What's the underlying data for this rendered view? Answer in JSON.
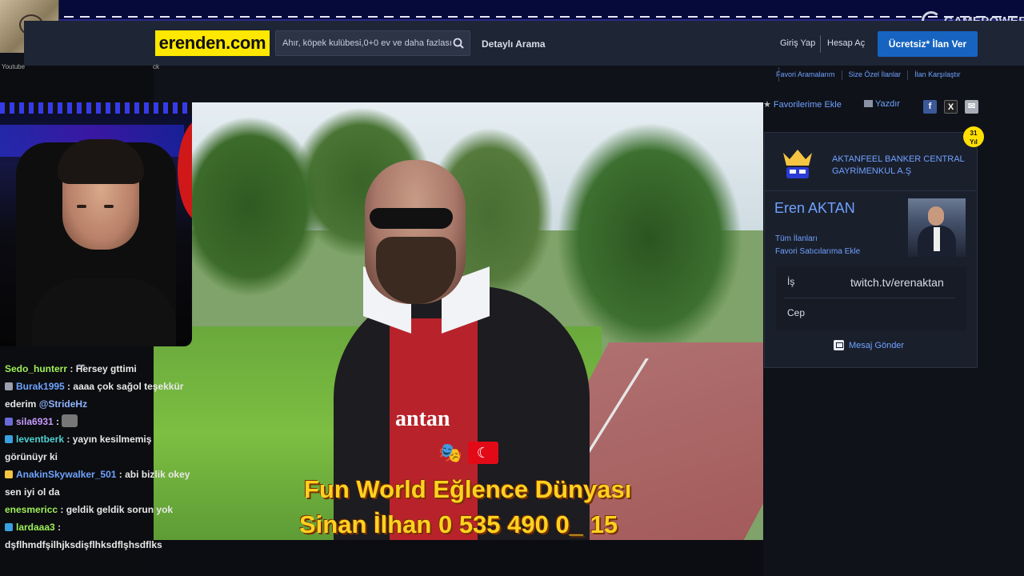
{
  "stream": {
    "youtube_label": "Youtube",
    "tk_label": "ck",
    "overlay_logo": "GAMEPOWER"
  },
  "site": {
    "brand": "erenden.com",
    "search_placeholder": "Ahır, köpek kulübesi,0+0 ev ve daha fazlası",
    "detailed_search": "Detaylı Arama",
    "login": "Giriş Yap",
    "signup": "Hesap Aç",
    "post_ad": "Ücretsiz* İlan Ver",
    "sub_links": [
      "Favori Aramalarım",
      "Size Özel İlanlar",
      "İlan Karşılaştır"
    ],
    "brand_color": "#ffe800",
    "accent_color": "#1664c0",
    "link_color": "#6fa2ff"
  },
  "listing": {
    "add_favorites": "Favorilerime Ekle",
    "print": "Yazdır",
    "social": [
      "f",
      "X",
      "✉"
    ]
  },
  "seller": {
    "badge_value": "31",
    "badge_unit": "Yıl",
    "company": "AKTANFEEL BANKER CENTRAL GAYRİMENKUL A.Ş",
    "name": "Eren AKTAN",
    "all_ads": "Tüm İlanları",
    "fav_seller": "Favori Satıcılarıma Ekle",
    "work_label": "İş",
    "work_value": "twitch.tv/erenaktan",
    "mobile_label": "Cep",
    "message": "Mesaj Gönder"
  },
  "video": {
    "shirt_text": "antan",
    "caption_line1": "Fun World Eğlence Dünyası",
    "caption_line2": "Sinan İlhan 0 535 490 0_ 15"
  },
  "chat": {
    "messages": [
      {
        "user": "Sedo_hunterr",
        "color": "#9ef05a",
        "badge": "",
        "text": "Hersey gttimi"
      },
      {
        "user": "Burak1995",
        "color": "#6fa2ff",
        "badge": "#9aa0ad",
        "text": "aaaa çok sağol teşekkür ederim",
        "mention": "@StrideHz"
      },
      {
        "user": "sila6931",
        "color": "#c79bff",
        "badge": "#6a6ad8",
        "text": "",
        "emote": "cat-emote"
      },
      {
        "user": "leventberk",
        "color": "#4fd1d1",
        "badge": "#3aa0e0",
        "text": "yayın kesilmemiş görünüyr ki"
      },
      {
        "user": "AnakinSkywalker_501",
        "color": "#6fa2ff",
        "badge": "#f5c542",
        "text": "abi bizlik okey sen iyi ol da"
      },
      {
        "user": "enesmericc",
        "color": "#9ef05a",
        "badge": "",
        "text": "geldik geldik sorun yok"
      },
      {
        "user": "lardaaa3",
        "color": "#9ef05a",
        "badge": "#3aa0e0",
        "text": "dşflhmdfşilhjksdişflhksdflşhsdflks"
      }
    ]
  }
}
